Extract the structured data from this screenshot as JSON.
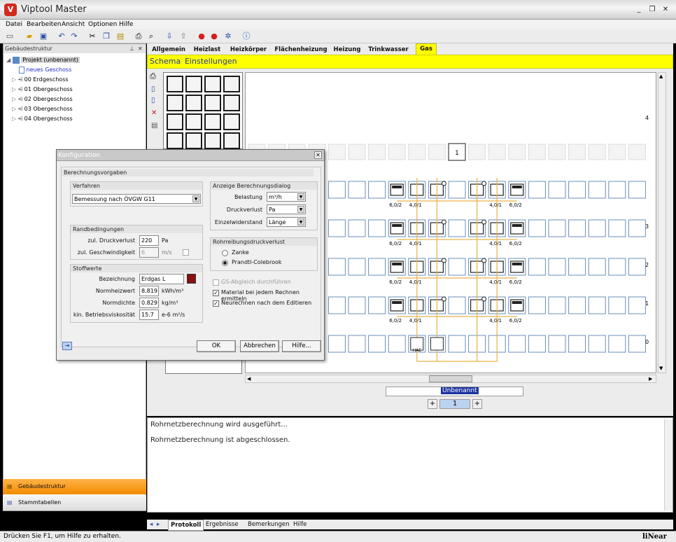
{
  "window": {
    "title": "Viptool Master",
    "minimize": "_",
    "restore": "❐",
    "close": "✕"
  },
  "menu": [
    "Datei",
    "Bearbeiten",
    "Ansicht",
    "Optionen",
    "Hilfe"
  ],
  "left_panel": {
    "header": "Gebäudestruktur",
    "pin": "⊥",
    "close": "✕",
    "tree": {
      "project": "Projekt (unbenannt)",
      "new_floor": "neues Geschoss",
      "floors": [
        "00 Erdgeschoss",
        "01 Obergeschoss",
        "02 Obergeschoss",
        "03 Obergeschoss",
        "04 Obergeschoss"
      ]
    },
    "nav": [
      "Gebäudestruktur",
      "Stammtabellen"
    ]
  },
  "tabs": [
    "Allgemein",
    "Heizlast",
    "Heizkörper",
    "Flächenheizung",
    "Heizung",
    "Trinkwasser",
    "Gas"
  ],
  "active_tab": "Gas",
  "subtabs": [
    "Schema",
    "Einstellungen"
  ],
  "schema": {
    "top_cell": "1",
    "floor_numbers": [
      "4",
      "3",
      "2",
      "1",
      "0"
    ],
    "pipe_labels": [
      "6,0/2",
      "4,0/1",
      "4,0/1",
      "6,0/2"
    ],
    "hae_label": "HAE"
  },
  "sheet": {
    "name": "Unbenannt",
    "page": "1",
    "add": "+"
  },
  "protocol": {
    "lines": [
      "Rohrnetzberechnung wird ausgeführt...",
      "Rohrnetzberechnung ist abgeschlossen."
    ]
  },
  "bottom_tabs": [
    "Protokoll",
    "Ergebnisse",
    "Bemerkungen",
    "Hilfe"
  ],
  "status": {
    "text": "Drücken Sie F1, um Hilfe zu erhalten.",
    "brand": "liNear"
  },
  "dialog": {
    "title": "Konfiguration",
    "close": "✕",
    "section": "Berechnungsvorgaben",
    "verfahren": {
      "title": "Verfahren",
      "value": "Bemessung nach ÖVGW G11"
    },
    "randbedingungen": {
      "title": "Randbedingungen",
      "druckverlust_label": "zul. Druckverlust",
      "druckverlust_value": "220",
      "druckverlust_unit": "Pa",
      "geschwindigkeit_label": "zul. Geschwindigkeit",
      "geschwindigkeit_value": "6",
      "geschwindigkeit_unit": "m/s"
    },
    "stoffwerte": {
      "title": "Stoffwerte",
      "bezeichnung_label": "Bezeichnung",
      "bezeichnung_value": "Erdgas L",
      "normheizwert_label": "Normheizwert",
      "normheizwert_value": "8.819",
      "normheizwert_unit": "kWh/m³",
      "normdichte_label": "Normdichte",
      "normdichte_value": "0.829",
      "normdichte_unit": "kg/m³",
      "viskositaet_label": "kin. Betriebsviskosität",
      "viskositaet_value": "15.7",
      "viskositaet_unit": "e-6 m²/s"
    },
    "anzeige": {
      "title": "Anzeige Berechnungsdialog",
      "belastung_label": "Belastung",
      "belastung_value": "m³/h",
      "druckverlust_label": "Druckverlust",
      "druckverlust_value": "Pa",
      "einzelwiderstand_label": "Einzelwiderstand",
      "einzelwiderstand_value": "Länge"
    },
    "rohrreibung": {
      "title": "Rohrreibungsdruckverlust",
      "option1": "Zanke",
      "option2": "Prandtl-Colebrook",
      "selected": "Prandtl-Colebrook"
    },
    "checks": {
      "gs_abgleich": "GS-Abgleich durchführen",
      "material": "Material bei jedem Rechnen ermitteln",
      "neurechnen": "Neurechnen nach dem Editieren"
    },
    "buttons": {
      "ok": "OK",
      "cancel": "Abbrechen",
      "help": "Hilfe..."
    }
  }
}
